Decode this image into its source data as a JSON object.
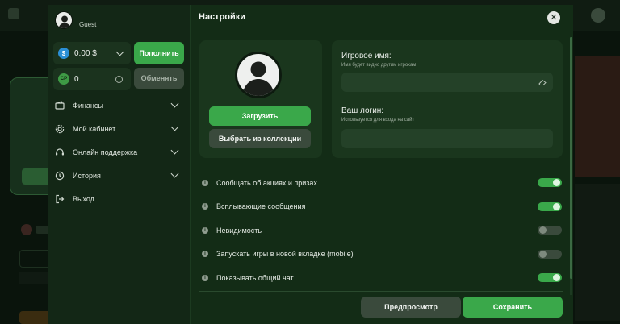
{
  "colors": {
    "accent": "#3aa84a",
    "panel": "#132c16",
    "card": "#1a361d",
    "secondary_button": "#3a4a3c"
  },
  "sidebar": {
    "user": {
      "name": "Guest",
      "avatar_icon": "user-silhouette-icon"
    },
    "balance": {
      "value": "0.00 $",
      "currency_icon": "dollar-coin-icon"
    },
    "points": {
      "value": "0",
      "currency_icon": "cp-coin-icon"
    },
    "topup_label": "Пополнить",
    "exchange_label": "Обменять",
    "menu": [
      {
        "label": "Финансы",
        "icon": "wallet-icon",
        "has_submenu": true
      },
      {
        "label": "Мой кабинет",
        "icon": "gear-icon",
        "has_submenu": true
      },
      {
        "label": "Онлайн поддержка",
        "icon": "headset-icon",
        "has_submenu": true
      },
      {
        "label": "История",
        "icon": "clock-icon",
        "has_submenu": true
      },
      {
        "label": "Выход",
        "icon": "logout-icon",
        "has_submenu": false
      }
    ]
  },
  "settings": {
    "title": "Настройки",
    "upload_label": "Загрузить",
    "collection_label": "Выбрать из коллекции",
    "game_name": {
      "label": "Игровое имя:",
      "hint": "Имя будет видно другим игрокам",
      "value": ""
    },
    "login": {
      "label": "Ваш логин:",
      "hint": "Используется для входа на сайт",
      "value": ""
    },
    "toggles": [
      {
        "label": "Сообщать об акциях и призах",
        "on": true
      },
      {
        "label": "Всплывающие сообщения",
        "on": true
      },
      {
        "label": "Невидимость",
        "on": false
      },
      {
        "label": "Запускать игры в новой вкладке (mobile)",
        "on": false
      },
      {
        "label": "Показывать общий чат",
        "on": true
      }
    ],
    "preview_label": "Предпросмотр",
    "save_label": "Сохранить"
  }
}
